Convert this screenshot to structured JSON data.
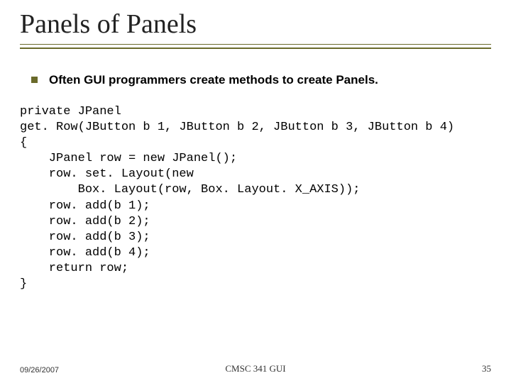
{
  "title": "Panels of Panels",
  "bullet": "Often GUI programmers create methods to create Panels.",
  "code": "private JPanel\nget. Row(JButton b 1, JButton b 2, JButton b 3, JButton b 4)\n{\n    JPanel row = new JPanel();\n    row. set. Layout(new\n        Box. Layout(row, Box. Layout. X_AXIS));\n    row. add(b 1);\n    row. add(b 2);\n    row. add(b 3);\n    row. add(b 4);\n    return row;\n}",
  "footer": {
    "date": "09/26/2007",
    "center": "CMSC 341 GUI",
    "page": "35"
  }
}
